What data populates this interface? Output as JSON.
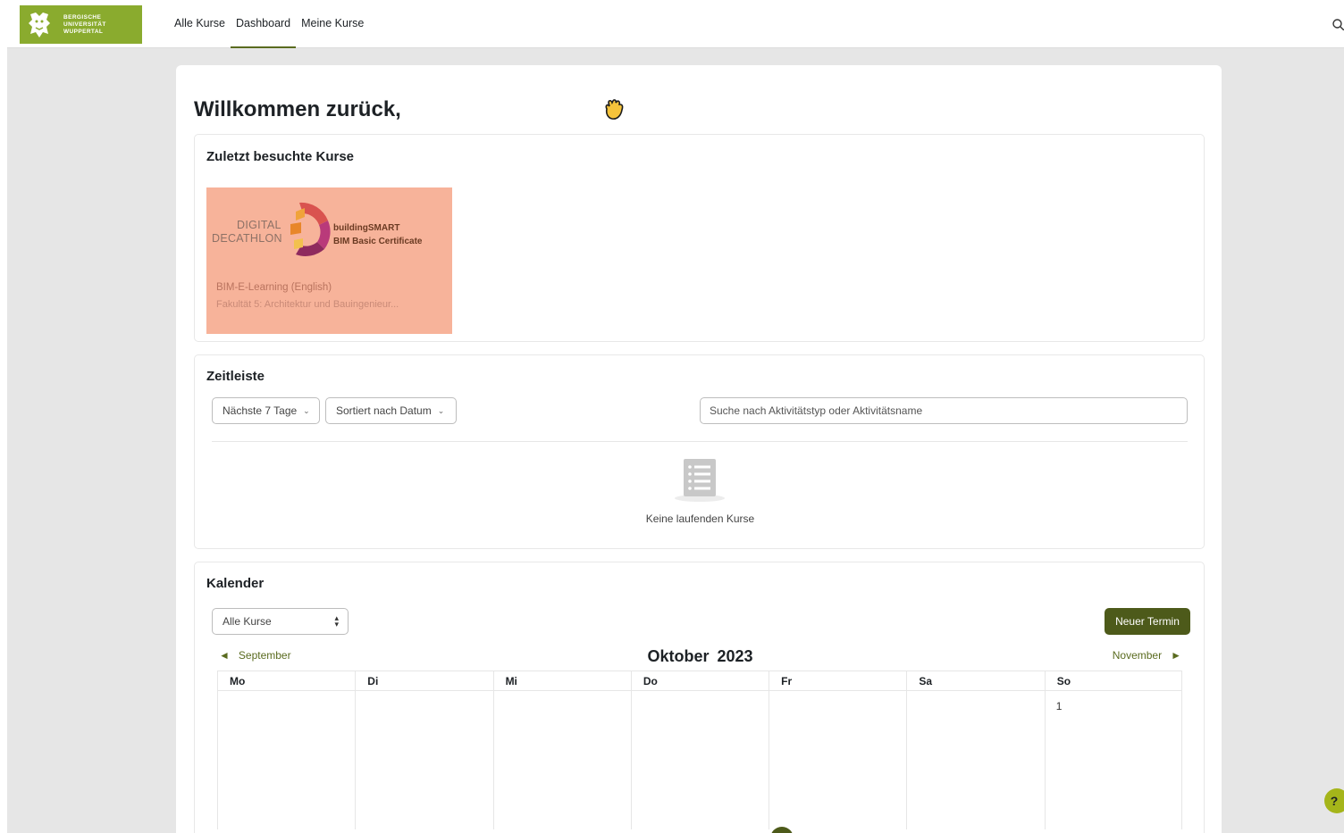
{
  "header": {
    "logo_lines": [
      "BERGISCHE",
      "UNIVERSITÄT",
      "WUPPERTAL"
    ],
    "nav": [
      {
        "label": "Alle Kurse",
        "active": false
      },
      {
        "label": "Dashboard",
        "active": true
      },
      {
        "label": "Meine Kurse",
        "active": false
      }
    ],
    "search_icon": "search-icon"
  },
  "welcome": {
    "title": "Willkommen zurück,",
    "emoji": "waving-hand"
  },
  "recent": {
    "title": "Zuletzt besuchte Kurse",
    "courses": [
      {
        "image_text_left": [
          "DIGITAL",
          "DECATHLON"
        ],
        "image_text_right": [
          "buildingSMART",
          "BIM Basic Certificate"
        ],
        "name": "BIM-E-Learning (English)",
        "category": "Fakultät 5: Architektur und Bauingenieur..."
      }
    ]
  },
  "timeline": {
    "title": "Zeitleiste",
    "filter_label": "Nächste 7 Tage",
    "sort_label": "Sortiert nach Datum",
    "search_placeholder": "Suche nach Aktivitätstyp oder Aktivitätsname",
    "empty_text": "Keine laufenden Kurse"
  },
  "calendar": {
    "title": "Kalender",
    "course_filter": "Alle Kurse",
    "new_event": "Neuer Termin",
    "prev_month": "September",
    "next_month": "November",
    "month": "Oktober",
    "year": "2023",
    "weekdays": [
      "Mo",
      "Di",
      "Mi",
      "Do",
      "Fr",
      "Sa",
      "So"
    ],
    "first_row": [
      "",
      "",
      "",
      "",
      "",
      "",
      "1"
    ]
  },
  "help": {
    "label": "?"
  },
  "colors": {
    "brand_green": "#8aab2e",
    "primary_button": "#4d5a1a",
    "course_tile": "#f7b39a"
  }
}
